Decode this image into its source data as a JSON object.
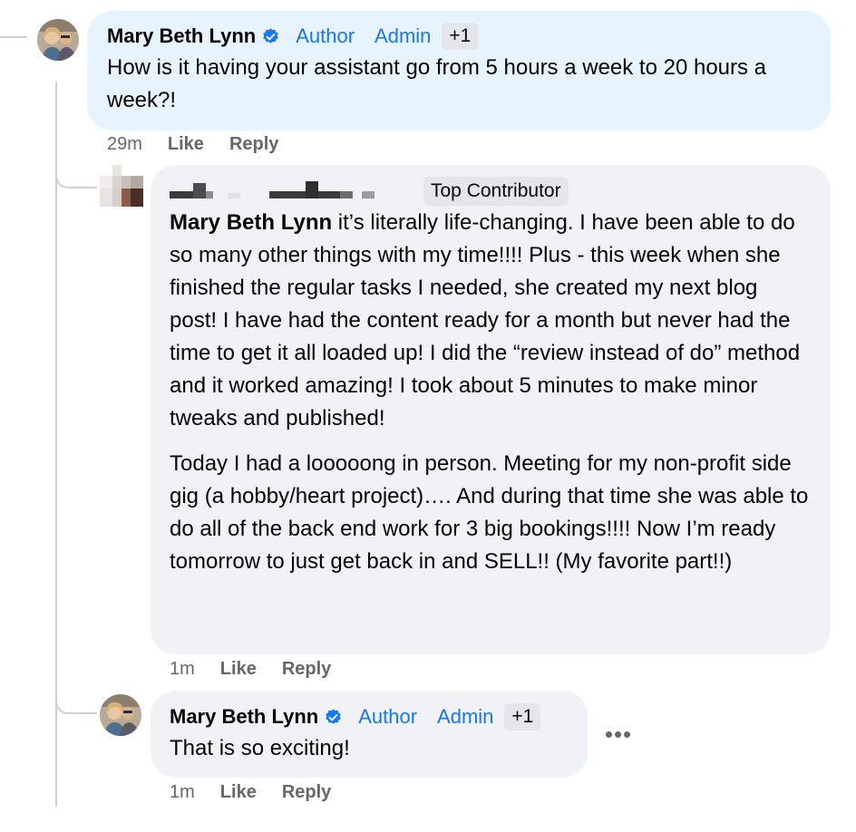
{
  "comments": [
    {
      "author": "Mary Beth Lynn",
      "roles": [
        "Author",
        "Admin"
      ],
      "extra_badge": "+1",
      "text": "How is it having your assistant go from 5 hours a week to 20 hours a week?!",
      "time": "29m",
      "like_label": "Like",
      "reply_label": "Reply"
    },
    {
      "badge": "Top Contributor",
      "mention": "Mary Beth Lynn",
      "paragraph1": " it’s literally life-changing. I have been able to do so many other things with my time!!!! Plus - this week when she finished the regular tasks I needed, she created my next blog post! I have had the content ready for a month but never had the time to get it all loaded up! I did the “review instead of do” method and it worked amazing! I took about 5 minutes to make minor tweaks and published!",
      "paragraph2": "Today I had a looooong in person. Meeting for my non-profit side gig (a hobby/heart project)…. And during that time she was able to do all of the back end work for 3 big bookings!!!! Now I’m ready tomorrow to just get back in and SELL!! (My favorite part!!)",
      "time": "1m",
      "like_label": "Like",
      "reply_label": "Reply"
    },
    {
      "author": "Mary Beth Lynn",
      "roles": [
        "Author",
        "Admin"
      ],
      "extra_badge": "+1",
      "text": "That is so exciting!",
      "time": "1m",
      "like_label": "Like",
      "reply_label": "Reply",
      "more_label": "•••"
    }
  ],
  "colors": {
    "highlight_bubble": "#e7f3ff",
    "bubble": "#f0f2f5",
    "role_link": "#1877f2",
    "meta_text": "#65676b",
    "verified": "#1877f2"
  },
  "icons": {
    "verified": "verified-badge-icon",
    "more": "more-options-icon"
  }
}
